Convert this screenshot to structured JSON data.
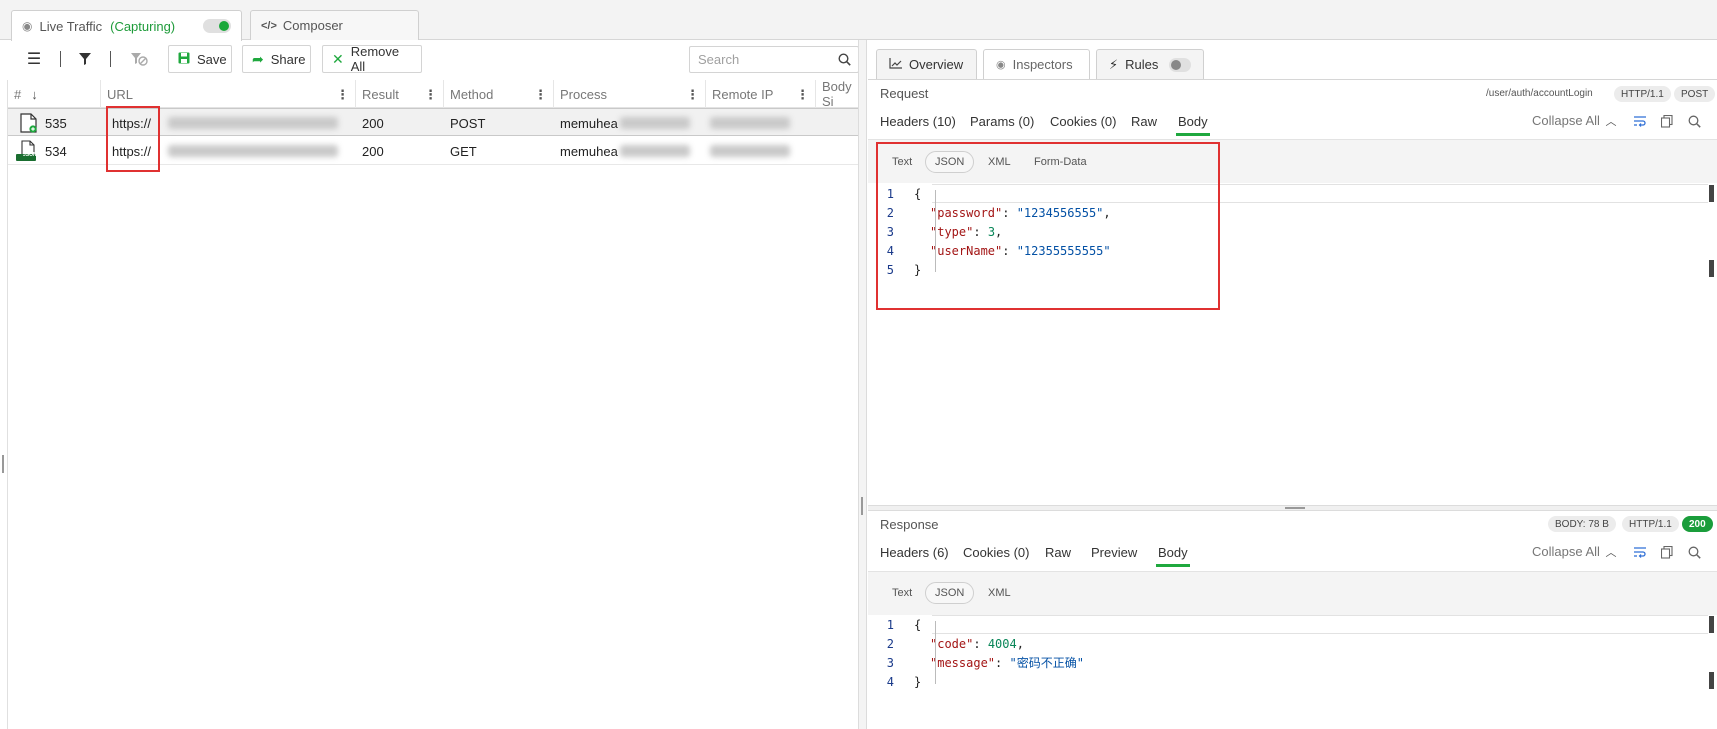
{
  "top_tabs": {
    "live_traffic": "Live Traffic",
    "capturing": "(Capturing)",
    "composer": "Composer"
  },
  "toolbar": {
    "save": "Save",
    "share": "Share",
    "remove_all": "Remove All",
    "search_placeholder": "Search"
  },
  "grid": {
    "columns": [
      "#",
      "URL",
      "Result",
      "Method",
      "Process",
      "Remote IP",
      "Body Si"
    ],
    "rows": [
      {
        "id": "535",
        "url": "https://",
        "result": "200",
        "method": "POST",
        "process": "memuhea",
        "selected": true
      },
      {
        "id": "534",
        "url": "https://",
        "result": "200",
        "method": "GET",
        "process": "memuhea",
        "selected": false
      }
    ],
    "json_badge": "JSON"
  },
  "right_tabs": {
    "overview": "Overview",
    "inspectors": "Inspectors",
    "rules": "Rules"
  },
  "request": {
    "title": "Request",
    "path": "/user/auth/accountLogin",
    "protocol": "HTTP/1.1",
    "method": "POST",
    "tabs": [
      "Headers (10)",
      "Params (0)",
      "Cookies (0)",
      "Raw",
      "Body"
    ],
    "collapse_all": "Collapse All",
    "formats": [
      "Text",
      "JSON",
      "XML",
      "Form-Data"
    ],
    "body_lines": [
      {
        "num": "1",
        "text": "{"
      },
      {
        "num": "2",
        "key": "\"password\"",
        "value": "\"1234556555\"",
        "type": "string",
        "trail": ","
      },
      {
        "num": "3",
        "key": "\"type\"",
        "value": "3",
        "type": "number",
        "trail": ","
      },
      {
        "num": "4",
        "key": "\"userName\"",
        "value": "\"12355555555\"",
        "type": "string",
        "trail": ""
      },
      {
        "num": "5",
        "text": "}"
      }
    ]
  },
  "response": {
    "title": "Response",
    "body_size": "BODY: 78 B",
    "protocol": "HTTP/1.1",
    "status": "200",
    "tabs": [
      "Headers (6)",
      "Cookies (0)",
      "Raw",
      "Preview",
      "Body"
    ],
    "collapse_all": "Collapse All",
    "formats": [
      "Text",
      "JSON",
      "XML"
    ],
    "body_lines": [
      {
        "num": "1",
        "text": "{"
      },
      {
        "num": "2",
        "key": "\"code\"",
        "value": "4004",
        "type": "number",
        "trail": ","
      },
      {
        "num": "3",
        "key": "\"message\"",
        "value": "\"密码不正确\"",
        "type": "string",
        "trail": ""
      },
      {
        "num": "4",
        "text": "}"
      }
    ]
  },
  "colors": {
    "accent_green": "#1fa83e",
    "highlight_red": "#e03131"
  }
}
